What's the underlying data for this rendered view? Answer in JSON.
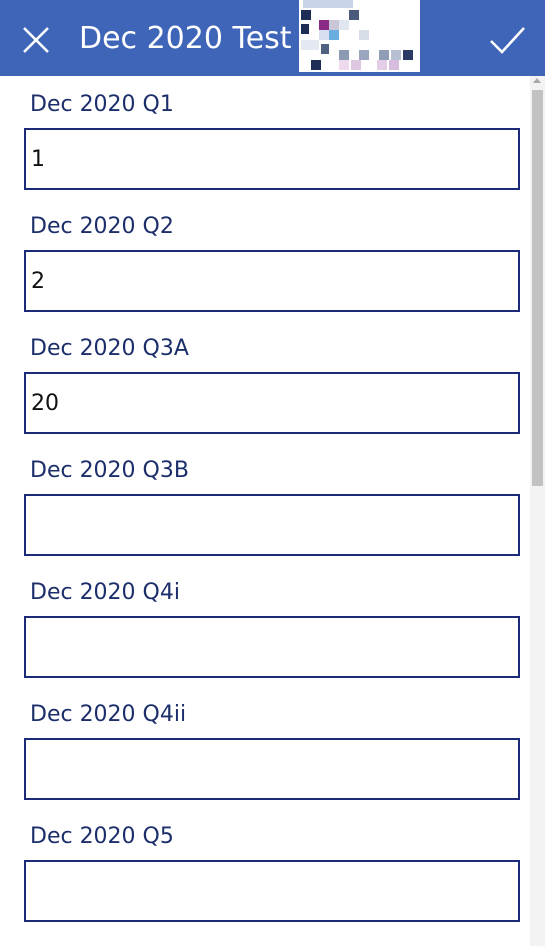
{
  "header": {
    "title": "Dec 2020 Test",
    "close_icon": "close-icon",
    "submit_icon": "checkmark-icon",
    "logo": "pixelated-logo",
    "background_color": "#3f65b9"
  },
  "form": {
    "fields": [
      {
        "label": "Dec 2020 Q1",
        "value": "1"
      },
      {
        "label": "Dec 2020 Q2",
        "value": "2"
      },
      {
        "label": "Dec 2020 Q3A",
        "value": "20"
      },
      {
        "label": "Dec 2020 Q3B",
        "value": ""
      },
      {
        "label": "Dec 2020 Q4i",
        "value": ""
      },
      {
        "label": "Dec 2020 Q4ii",
        "value": ""
      },
      {
        "label": "Dec 2020 Q5",
        "value": ""
      }
    ],
    "label_color": "#1c2f6b",
    "border_color": "#1c2a78"
  }
}
